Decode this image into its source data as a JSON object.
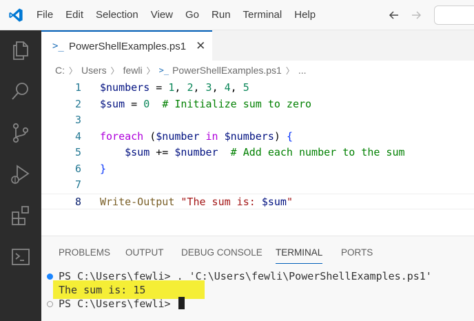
{
  "menu": [
    "File",
    "Edit",
    "Selection",
    "View",
    "Go",
    "Run",
    "Terminal",
    "Help"
  ],
  "tab": {
    "icon_text": ">_",
    "label": "PowerShellExamples.ps1",
    "close": "✕"
  },
  "breadcrumb": {
    "parts": [
      "C:",
      "Users",
      "fewli"
    ],
    "file": "PowerShellExamples.ps1",
    "more": "..."
  },
  "editor": {
    "lines": [
      {
        "n": "1",
        "tokens": [
          [
            "var",
            "$numbers"
          ],
          [
            "op",
            " = "
          ],
          [
            "num",
            "1"
          ],
          [
            "op",
            ", "
          ],
          [
            "num",
            "2"
          ],
          [
            "op",
            ", "
          ],
          [
            "num",
            "3"
          ],
          [
            "op",
            ", "
          ],
          [
            "num",
            "4"
          ],
          [
            "op",
            ", "
          ],
          [
            "num",
            "5"
          ]
        ]
      },
      {
        "n": "2",
        "tokens": [
          [
            "var",
            "$sum"
          ],
          [
            "op",
            " = "
          ],
          [
            "num",
            "0"
          ],
          [
            "op",
            "  "
          ],
          [
            "cmt",
            "# Initialize sum to zero"
          ]
        ]
      },
      {
        "n": "3",
        "tokens": []
      },
      {
        "n": "4",
        "tokens": [
          [
            "kw",
            "foreach"
          ],
          [
            "op",
            " ("
          ],
          [
            "var",
            "$number"
          ],
          [
            "op",
            " "
          ],
          [
            "kw",
            "in"
          ],
          [
            "op",
            " "
          ],
          [
            "var",
            "$numbers"
          ],
          [
            "op",
            ") "
          ],
          [
            "brace",
            "{"
          ]
        ]
      },
      {
        "n": "5",
        "tokens": [
          [
            "op",
            "    "
          ],
          [
            "var",
            "$sum"
          ],
          [
            "op",
            " += "
          ],
          [
            "var",
            "$number"
          ],
          [
            "op",
            "  "
          ],
          [
            "cmt",
            "# Add each number to the sum"
          ]
        ]
      },
      {
        "n": "6",
        "tokens": [
          [
            "brace",
            "}"
          ]
        ]
      },
      {
        "n": "7",
        "tokens": []
      },
      {
        "n": "8",
        "tokens": [
          [
            "fn",
            "Write-Output"
          ],
          [
            "op",
            " "
          ],
          [
            "str",
            "\"The sum is: "
          ],
          [
            "strvar",
            "$sum"
          ],
          [
            "str",
            "\""
          ]
        ]
      }
    ]
  },
  "panel": {
    "tabs": [
      "PROBLEMS",
      "OUTPUT",
      "DEBUG CONSOLE",
      "TERMINAL",
      "PORTS"
    ],
    "active_tab": "TERMINAL",
    "terminal": {
      "line1": "PS C:\\Users\\fewli> . 'C:\\Users\\fewli\\PowerShellExamples.ps1'",
      "line2": "The sum is: 15",
      "line3": "PS C:\\Users\\fewli> "
    }
  },
  "colors": {
    "accent": "#005fb8",
    "activity_bar": "#2c2c2c",
    "highlight": "#f5ee36"
  }
}
